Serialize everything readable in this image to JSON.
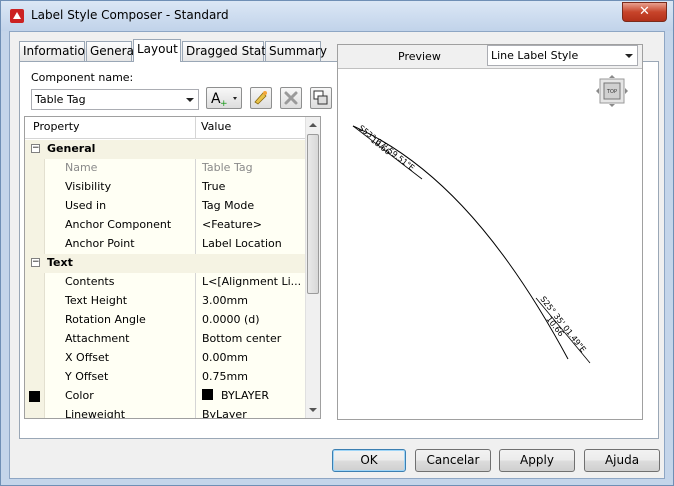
{
  "window": {
    "title": "Label Style Composer - Standard",
    "close_glyph": "✕"
  },
  "tabs": [
    {
      "label": "Information"
    },
    {
      "label": "General"
    },
    {
      "label": "Layout"
    },
    {
      "label": "Dragged State"
    },
    {
      "label": "Summary"
    }
  ],
  "component": {
    "label": "Component name:",
    "selected": "Table Tag",
    "add_button_glyph": "A"
  },
  "grid": {
    "headers": {
      "property": "Property",
      "value": "Value"
    },
    "rows": [
      {
        "type": "category",
        "name": "General",
        "expander": "−"
      },
      {
        "type": "prop",
        "name": "Name",
        "value": "Table Tag",
        "disabled": true
      },
      {
        "type": "prop",
        "name": "Visibility",
        "value": "True"
      },
      {
        "type": "prop",
        "name": "Used in",
        "value": "Tag Mode"
      },
      {
        "type": "prop",
        "name": "Anchor Component",
        "value": "<Feature>"
      },
      {
        "type": "prop",
        "name": "Anchor Point",
        "value": "Label Location"
      },
      {
        "type": "category",
        "name": "Text",
        "expander": "−"
      },
      {
        "type": "prop",
        "name": "Contents",
        "value": "L<[Alignment Li..."
      },
      {
        "type": "prop",
        "name": "Text Height",
        "value": "3.00mm"
      },
      {
        "type": "prop",
        "name": "Rotation Angle",
        "value": "0.0000 (d)"
      },
      {
        "type": "prop",
        "name": "Attachment",
        "value": "Bottom center"
      },
      {
        "type": "prop",
        "name": "X Offset",
        "value": "0.00mm"
      },
      {
        "type": "prop",
        "name": "Y Offset",
        "value": "0.75mm"
      },
      {
        "type": "prop",
        "name": "Color",
        "value": "BYLAYER",
        "swatch": true
      },
      {
        "type": "prop",
        "name": "Lineweight",
        "value": "ByLayer"
      }
    ]
  },
  "preview": {
    "label": "Preview",
    "style_selected": "Line Label Style",
    "viewcube_label": "TOP",
    "annotations": {
      "top_line1": "S53° 07' 59.51\"E",
      "top_line2": "10.66",
      "bottom_line1": "S25° 35' 01.49\"E",
      "bottom_line2": "10.66"
    }
  },
  "buttons": {
    "ok": "OK",
    "cancel": "Cancelar",
    "apply": "Apply",
    "help": "Ajuda"
  },
  "colors": {
    "title_bar": "#c4d5ea",
    "grid_bg": "#fffff4",
    "close": "#c7442a"
  }
}
